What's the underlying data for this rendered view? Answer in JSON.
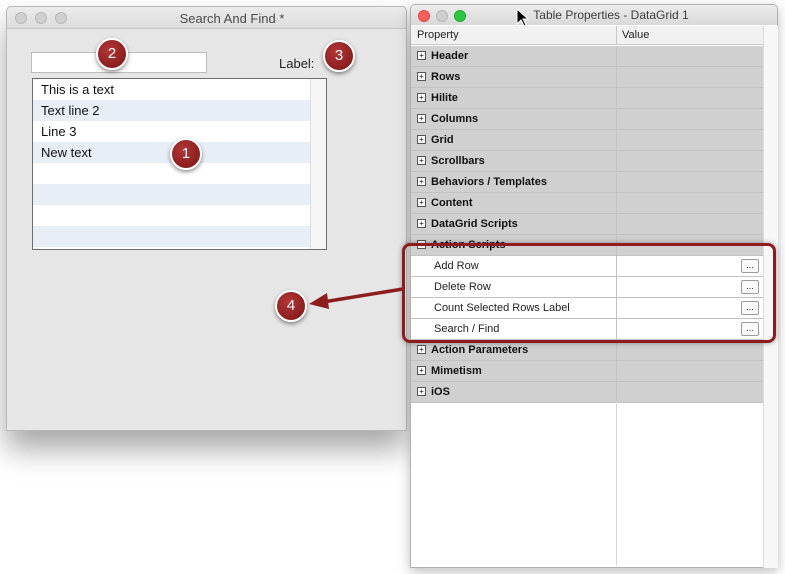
{
  "left_window": {
    "title": "Search And Find *",
    "label_text": "Label:",
    "search_value": "",
    "grid_rows": [
      "This is a text",
      "Text line 2",
      "Line 3",
      "New text",
      "",
      "",
      "",
      ""
    ]
  },
  "right_window": {
    "title": "Table Properties - DataGrid 1",
    "columns": [
      "Property",
      "Value"
    ],
    "rows": [
      {
        "label": "Header",
        "kind": "section",
        "expander": "+"
      },
      {
        "label": "Rows",
        "kind": "section",
        "expander": "+"
      },
      {
        "label": "Hilite",
        "kind": "section",
        "expander": "+"
      },
      {
        "label": "Columns",
        "kind": "section",
        "expander": "+"
      },
      {
        "label": "Grid",
        "kind": "section",
        "expander": "+"
      },
      {
        "label": "Scrollbars",
        "kind": "section",
        "expander": "+"
      },
      {
        "label": "Behaviors / Templates",
        "kind": "section",
        "expander": "+"
      },
      {
        "label": "Content",
        "kind": "section",
        "expander": "+"
      },
      {
        "label": "DataGrid Scripts",
        "kind": "section",
        "expander": "+"
      },
      {
        "label": "Action Scripts",
        "kind": "section",
        "expander": "-"
      },
      {
        "label": "Add Row",
        "kind": "item",
        "button": "..."
      },
      {
        "label": "Delete Row",
        "kind": "item",
        "button": "..."
      },
      {
        "label": "Count Selected Rows Label",
        "kind": "item",
        "button": "..."
      },
      {
        "label": "Search / Find",
        "kind": "item",
        "button": "..."
      },
      {
        "label": "Action Parameters",
        "kind": "section",
        "expander": "+"
      },
      {
        "label": "Mimetism",
        "kind": "section",
        "expander": "+"
      },
      {
        "label": "iOS",
        "kind": "section",
        "expander": "+"
      }
    ]
  },
  "annotations": {
    "badge1": "1",
    "badge2": "2",
    "badge3": "3",
    "badge4": "4"
  },
  "colors": {
    "badge": "#8d1d1d",
    "section_row": "#d0d0d0",
    "grid_alt_row": "#e8eef6"
  }
}
